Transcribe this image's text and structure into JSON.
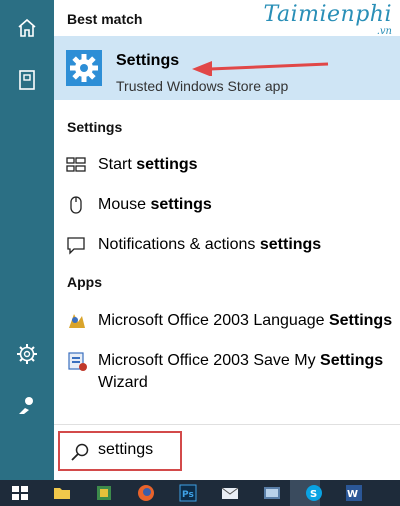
{
  "watermark": {
    "brand": "Taimienphi",
    "domain": ".vn"
  },
  "sidebar": {
    "items": [
      {
        "icon": "home-icon"
      },
      {
        "icon": "documents-icon"
      },
      {
        "icon": "gear-icon"
      },
      {
        "icon": "feedback-icon"
      }
    ]
  },
  "best_match": {
    "header": "Best match",
    "title": "Settings",
    "subtitle": "Trusted Windows Store app",
    "icon": "settings-gear-icon"
  },
  "settings_section": {
    "header": "Settings",
    "items": [
      {
        "prefix": "Start ",
        "bold": "settings",
        "icon": "start-layout-icon"
      },
      {
        "prefix": "Mouse ",
        "bold": "settings",
        "icon": "mouse-icon"
      },
      {
        "prefix": "Notifications & actions ",
        "bold": "settings",
        "icon": "notification-icon"
      }
    ]
  },
  "apps_section": {
    "header": "Apps",
    "items": [
      {
        "prefix": "Microsoft Office 2003 Language ",
        "bold": "Settings",
        "suffix": "",
        "icon": "office-language-icon"
      },
      {
        "prefix": "Microsoft Office 2003 Save My ",
        "bold": "Settings",
        "suffix": " Wizard",
        "icon": "office-wizard-icon"
      }
    ]
  },
  "search": {
    "value": "settings",
    "icon": "search-icon"
  },
  "taskbar": {
    "items": [
      "windows-start-icon",
      "file-explorer-icon",
      "app-icon",
      "firefox-icon",
      "photoshop-icon",
      "mail-icon",
      "app-icon",
      "app-icon",
      "skype-icon",
      "word-icon"
    ]
  },
  "colors": {
    "sidebar": "#2b6f84",
    "highlight": "#cfe5f5",
    "accent": "#2d8ed6",
    "arrow": "#e14747",
    "taskbar": "#1e2b3a"
  }
}
